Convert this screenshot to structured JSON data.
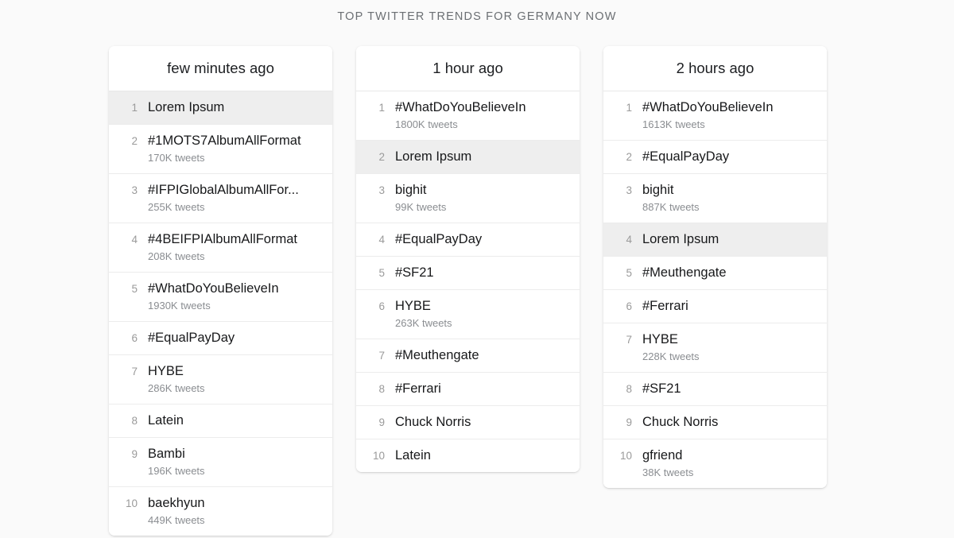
{
  "header": {
    "title": "TOP TWITTER TRENDS FOR GERMANY NOW"
  },
  "theme": {
    "background": "#fafafa",
    "card_background": "#ffffff",
    "highlight_row": "#eeeeee",
    "title_color": "#6b6f73",
    "rank_color": "#9a9a9a",
    "name_color": "#17181a",
    "count_color": "#8a8d91",
    "divider_color": "#ececec"
  },
  "columns": [
    {
      "id": "few-minutes-ago",
      "title": "few minutes ago",
      "items": [
        {
          "rank": "1",
          "name": "Lorem Ipsum",
          "count": "",
          "highlighted": true
        },
        {
          "rank": "2",
          "name": "#1MOTS7AlbumAllFormat",
          "count": "170K tweets",
          "highlighted": false
        },
        {
          "rank": "3",
          "name": "#IFPIGlobalAlbumAllFor...",
          "count": "255K tweets",
          "highlighted": false
        },
        {
          "rank": "4",
          "name": "#4BEIFPIAlbumAllFormat",
          "count": "208K tweets",
          "highlighted": false
        },
        {
          "rank": "5",
          "name": "#WhatDoYouBelieveIn",
          "count": "1930K tweets",
          "highlighted": false
        },
        {
          "rank": "6",
          "name": "#EqualPayDay",
          "count": "",
          "highlighted": false
        },
        {
          "rank": "7",
          "name": "HYBE",
          "count": "286K tweets",
          "highlighted": false
        },
        {
          "rank": "8",
          "name": "Latein",
          "count": "",
          "highlighted": false
        },
        {
          "rank": "9",
          "name": "Bambi",
          "count": "196K tweets",
          "highlighted": false
        },
        {
          "rank": "10",
          "name": "baekhyun",
          "count": "449K tweets",
          "highlighted": false
        }
      ]
    },
    {
      "id": "one-hour-ago",
      "title": "1 hour ago",
      "items": [
        {
          "rank": "1",
          "name": "#WhatDoYouBelieveIn",
          "count": "1800K tweets",
          "highlighted": false
        },
        {
          "rank": "2",
          "name": "Lorem Ipsum",
          "count": "",
          "highlighted": true
        },
        {
          "rank": "3",
          "name": "bighit",
          "count": "99K tweets",
          "highlighted": false
        },
        {
          "rank": "4",
          "name": "#EqualPayDay",
          "count": "",
          "highlighted": false
        },
        {
          "rank": "5",
          "name": "#SF21",
          "count": "",
          "highlighted": false
        },
        {
          "rank": "6",
          "name": "HYBE",
          "count": "263K tweets",
          "highlighted": false
        },
        {
          "rank": "7",
          "name": "#Meuthengate",
          "count": "",
          "highlighted": false
        },
        {
          "rank": "8",
          "name": "#Ferrari",
          "count": "",
          "highlighted": false
        },
        {
          "rank": "9",
          "name": "Chuck Norris",
          "count": "",
          "highlighted": false
        },
        {
          "rank": "10",
          "name": "Latein",
          "count": "",
          "highlighted": false
        }
      ]
    },
    {
      "id": "two-hours-ago",
      "title": "2 hours ago",
      "items": [
        {
          "rank": "1",
          "name": "#WhatDoYouBelieveIn",
          "count": "1613K tweets",
          "highlighted": false
        },
        {
          "rank": "2",
          "name": "#EqualPayDay",
          "count": "",
          "highlighted": false
        },
        {
          "rank": "3",
          "name": "bighit",
          "count": "887K tweets",
          "highlighted": false
        },
        {
          "rank": "4",
          "name": "Lorem Ipsum",
          "count": "",
          "highlighted": true
        },
        {
          "rank": "5",
          "name": "#Meuthengate",
          "count": "",
          "highlighted": false
        },
        {
          "rank": "6",
          "name": "#Ferrari",
          "count": "",
          "highlighted": false
        },
        {
          "rank": "7",
          "name": "HYBE",
          "count": "228K tweets",
          "highlighted": false
        },
        {
          "rank": "8",
          "name": "#SF21",
          "count": "",
          "highlighted": false
        },
        {
          "rank": "9",
          "name": "Chuck Norris",
          "count": "",
          "highlighted": false
        },
        {
          "rank": "10",
          "name": "gfriend",
          "count": "38K tweets",
          "highlighted": false
        }
      ]
    }
  ]
}
